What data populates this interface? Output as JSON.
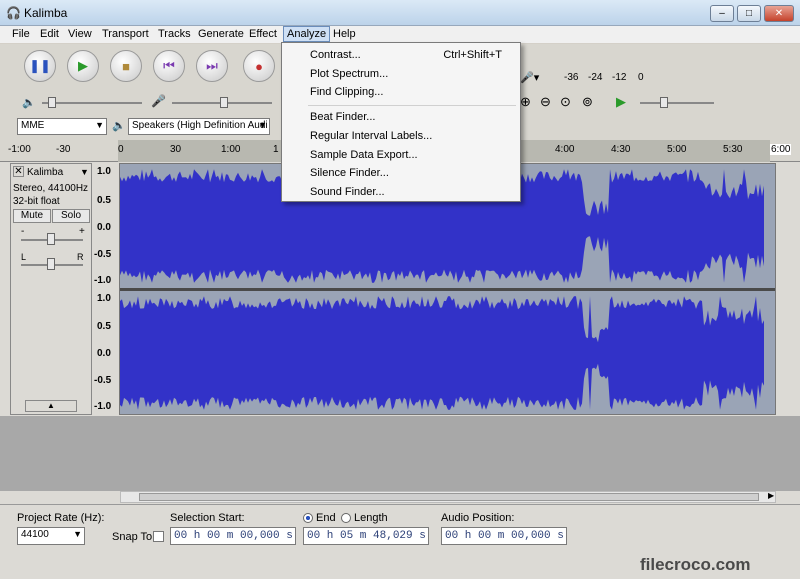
{
  "window": {
    "title": "Kalimba",
    "minimize": "–",
    "maximize": "□",
    "close": "✕"
  },
  "menu": [
    "File",
    "Edit",
    "View",
    "Transport",
    "Tracks",
    "Generate",
    "Effect",
    "Analyze",
    "Help"
  ],
  "analyze_menu": {
    "items": [
      {
        "label": "Contrast...",
        "shortcut": "Ctrl+Shift+T"
      },
      {
        "label": "Plot Spectrum..."
      },
      {
        "label": "Find Clipping..."
      },
      {
        "label": "Beat Finder..."
      },
      {
        "label": "Regular Interval Labels..."
      },
      {
        "label": "Sample Data Export..."
      },
      {
        "label": "Silence Finder..."
      },
      {
        "label": "Sound Finder..."
      }
    ]
  },
  "meter": {
    "labels": [
      "-36",
      "-24",
      "-12",
      "0"
    ]
  },
  "devices": {
    "host": "MME",
    "output": "Speakers (High Definition Audi"
  },
  "ruler": {
    "ticks": [
      "-1:00",
      "-30",
      "0",
      "30",
      "1:00",
      "1",
      "4:00",
      "4:30",
      "5:00",
      "5:30",
      "6:00"
    ]
  },
  "track": {
    "name": "Kalimba",
    "format": "Stereo, 44100Hz",
    "bitdepth": "32-bit float",
    "mute": "Mute",
    "solo": "Solo",
    "pan_l": "L",
    "pan_r": "R",
    "gain_minus": "-",
    "gain_plus": "+"
  },
  "vruler": {
    "top": [
      "1.0",
      "0.5",
      "0.0",
      "-0.5",
      "-1.0"
    ],
    "bottom": [
      "1.0",
      "0.5",
      "0.0",
      "-0.5",
      "-1.0"
    ]
  },
  "selection_bar": {
    "project_rate_label": "Project Rate (Hz):",
    "project_rate": "44100",
    "snap_to": "Snap To",
    "selection_start_label": "Selection Start:",
    "selection_start": "00 h 00 m 00,000 s",
    "end_label": "End",
    "length_label": "Length",
    "end": "00 h 05 m 48,029 s",
    "audio_position_label": "Audio Position:",
    "audio_position": "00 h 00 m 00,000 s"
  },
  "watermark": "filecroco.com",
  "colors": {
    "waveform": "#3232c8",
    "selected_bg": "#9aa4b6",
    "accent": "#2b3f77"
  }
}
